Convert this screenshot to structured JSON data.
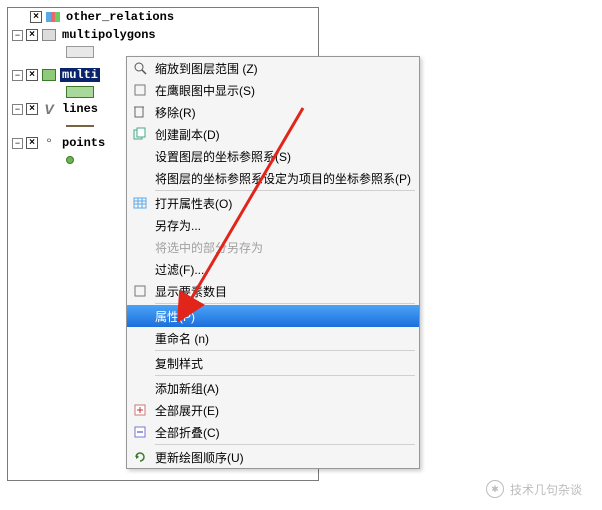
{
  "tree": {
    "items": [
      {
        "label": "other_relations",
        "checked": true
      },
      {
        "label": "multipolygons",
        "checked": true
      },
      {
        "label": "multi",
        "checked": true,
        "selected": true
      },
      {
        "label": "lines",
        "checked": true
      },
      {
        "label": "points",
        "checked": true
      }
    ]
  },
  "menu": {
    "items": [
      {
        "label": "缩放到图层范围 (Z)"
      },
      {
        "label": "在鹰眼图中显示(S)"
      },
      {
        "label": "移除(R)"
      },
      {
        "label": "创建副本(D)"
      },
      {
        "label": "设置图层的坐标参照系(S)"
      },
      {
        "label": "将图层的坐标参照系设定为项目的坐标参照系(P)"
      },
      {
        "label": "打开属性表(O)"
      },
      {
        "label": "另存为..."
      },
      {
        "label": "将选中的部分另存为",
        "disabled": true
      },
      {
        "label": "过滤(F)..."
      },
      {
        "label": "显示要素数目"
      },
      {
        "label": "属性(P)",
        "hover": true
      },
      {
        "label": "重命名 (n)"
      },
      {
        "label": "复制样式"
      },
      {
        "label": "添加新组(A)"
      },
      {
        "label": "全部展开(E)"
      },
      {
        "label": "全部折叠(C)"
      },
      {
        "label": "更新绘图顺序(U)"
      }
    ]
  },
  "watermark": {
    "text": "技术几句杂谈"
  }
}
